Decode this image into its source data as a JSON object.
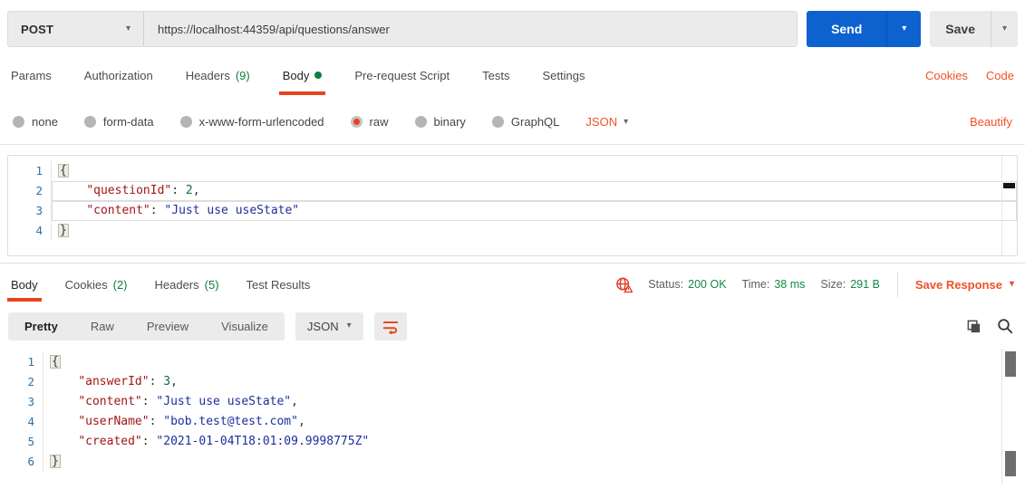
{
  "colors": {
    "accent_orange": "#ef512a",
    "underline_orange": "#e8431c",
    "send_blue": "#0d62d0",
    "green": "#0f7d3e",
    "line_number_blue": "#2d70a5",
    "json_key": "#a31515",
    "json_string": "#1c2f9c",
    "json_number": "#116b47"
  },
  "request_bar": {
    "method": "POST",
    "url": "https://localhost:44359/api/questions/answer",
    "send_label": "Send",
    "save_label": "Save"
  },
  "request_tabs": {
    "items": [
      {
        "label": "Params"
      },
      {
        "label": "Authorization"
      },
      {
        "label": "Headers",
        "count": "(9)"
      },
      {
        "label": "Body",
        "active": true,
        "dot": true
      },
      {
        "label": "Pre-request Script"
      },
      {
        "label": "Tests"
      },
      {
        "label": "Settings"
      }
    ],
    "links": [
      {
        "id": "cookies",
        "label": "Cookies"
      },
      {
        "id": "code",
        "label": "Code"
      }
    ]
  },
  "body_type": {
    "options": [
      {
        "label": "none"
      },
      {
        "label": "form-data"
      },
      {
        "label": "x-www-form-urlencoded"
      },
      {
        "label": "raw",
        "selected": true
      },
      {
        "label": "binary"
      },
      {
        "label": "GraphQL"
      }
    ],
    "format": "JSON",
    "beautify_label": "Beautify"
  },
  "request_editor": {
    "lines": [
      {
        "num": "1",
        "tokens": [
          {
            "c": "brace",
            "v": "{"
          }
        ]
      },
      {
        "num": "2",
        "hl": true,
        "tokens": [
          {
            "c": "ws",
            "v": "    "
          },
          {
            "c": "key",
            "v": "\"questionId\""
          },
          {
            "c": "punc",
            "v": ": "
          },
          {
            "c": "num",
            "v": "2"
          },
          {
            "c": "punc",
            "v": ","
          }
        ]
      },
      {
        "num": "3",
        "hl": true,
        "tokens": [
          {
            "c": "ws",
            "v": "    "
          },
          {
            "c": "key",
            "v": "\"content\""
          },
          {
            "c": "punc",
            "v": ": "
          },
          {
            "c": "str",
            "v": "\"Just use useState\""
          }
        ]
      },
      {
        "num": "4",
        "tokens": [
          {
            "c": "brace",
            "v": "}"
          }
        ]
      }
    ]
  },
  "response": {
    "tabs": [
      {
        "label": "Body",
        "active": true
      },
      {
        "label": "Cookies",
        "count": "(2)"
      },
      {
        "label": "Headers",
        "count": "(5)"
      },
      {
        "label": "Test Results"
      }
    ],
    "meta": {
      "status_label": "Status:",
      "status_value": "200 OK",
      "time_label": "Time:",
      "time_value": "38 ms",
      "size_label": "Size:",
      "size_value": "291 B",
      "save_label": "Save Response"
    },
    "view_tabs": [
      {
        "label": "Pretty",
        "active": true
      },
      {
        "label": "Raw"
      },
      {
        "label": "Preview"
      },
      {
        "label": "Visualize"
      }
    ],
    "format": "JSON",
    "editor": {
      "lines": [
        {
          "num": "1",
          "tokens": [
            {
              "c": "brace",
              "v": "{"
            }
          ]
        },
        {
          "num": "2",
          "tokens": [
            {
              "c": "ws",
              "v": "    "
            },
            {
              "c": "key",
              "v": "\"answerId\""
            },
            {
              "c": "punc",
              "v": ": "
            },
            {
              "c": "num",
              "v": "3"
            },
            {
              "c": "punc",
              "v": ","
            }
          ]
        },
        {
          "num": "3",
          "tokens": [
            {
              "c": "ws",
              "v": "    "
            },
            {
              "c": "key",
              "v": "\"content\""
            },
            {
              "c": "punc",
              "v": ": "
            },
            {
              "c": "str",
              "v": "\"Just use useState\""
            },
            {
              "c": "punc",
              "v": ","
            }
          ]
        },
        {
          "num": "4",
          "tokens": [
            {
              "c": "ws",
              "v": "    "
            },
            {
              "c": "key",
              "v": "\"userName\""
            },
            {
              "c": "punc",
              "v": ": "
            },
            {
              "c": "str",
              "v": "\"bob.test@test.com\""
            },
            {
              "c": "punc",
              "v": ","
            }
          ]
        },
        {
          "num": "5",
          "tokens": [
            {
              "c": "ws",
              "v": "    "
            },
            {
              "c": "key",
              "v": "\"created\""
            },
            {
              "c": "punc",
              "v": ": "
            },
            {
              "c": "str",
              "v": "\"2021-01-04T18:01:09.9998775Z\""
            }
          ]
        },
        {
          "num": "6",
          "tokens": [
            {
              "c": "brace",
              "v": "}"
            }
          ]
        }
      ]
    }
  }
}
